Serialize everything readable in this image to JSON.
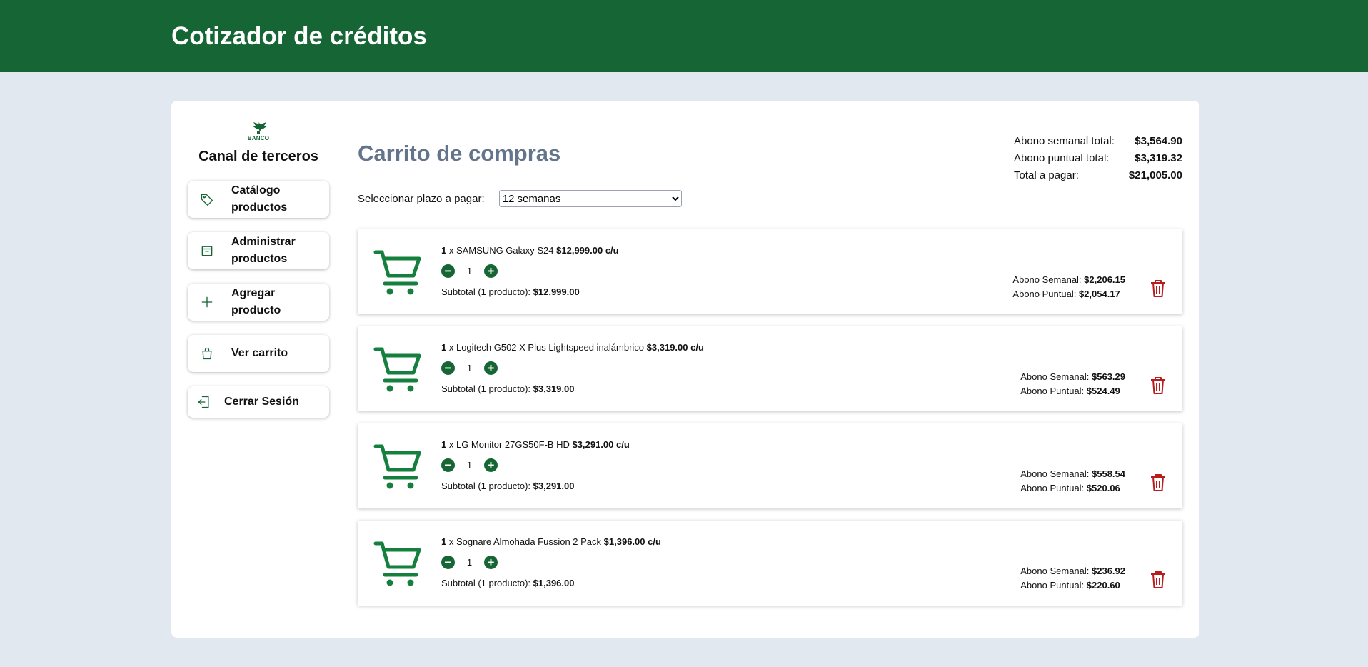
{
  "header": {
    "title": "Cotizador de créditos"
  },
  "sidebar": {
    "logo_text": "BANCO",
    "title": "Canal de terceros",
    "items": [
      {
        "label": "Catálogo productos",
        "icon": "tag-icon"
      },
      {
        "label": "Administrar productos",
        "icon": "archive-icon"
      },
      {
        "label": "Agregar producto",
        "icon": "plus-icon"
      },
      {
        "label": "Ver carrito",
        "icon": "shopping-bag-icon"
      },
      {
        "label": "Cerrar Sesión",
        "icon": "logout-icon"
      }
    ]
  },
  "cart": {
    "title": "Carrito de compras",
    "plazo_label": "Seleccionar plazo a pagar:",
    "plazo_selected": "12 semanas",
    "totals": [
      {
        "label": "Abono semanal total:",
        "value": "$3,564.90"
      },
      {
        "label": "Abono puntual total:",
        "value": "$3,319.32"
      },
      {
        "label": "Total a pagar:",
        "value": "$21,005.00"
      }
    ],
    "items": [
      {
        "qty": "1",
        "sep": " x ",
        "name": "SAMSUNG Galaxy S24",
        "price": "$12,999.00 c/u",
        "qty_value": "1",
        "subtotal_label": "Subtotal (1 producto): ",
        "subtotal": "$12,999.00",
        "semanal_label": "Abono Semanal: ",
        "semanal": "$2,206.15",
        "puntual_label": "Abono Puntual: ",
        "puntual": "$2,054.17"
      },
      {
        "qty": "1",
        "sep": " x ",
        "name": "Logitech G502 X Plus Lightspeed inalámbrico",
        "price": "$3,319.00 c/u",
        "qty_value": "1",
        "subtotal_label": "Subtotal (1 producto): ",
        "subtotal": "$3,319.00",
        "semanal_label": "Abono Semanal: ",
        "semanal": "$563.29",
        "puntual_label": "Abono Puntual: ",
        "puntual": "$524.49"
      },
      {
        "qty": "1",
        "sep": " x ",
        "name": "LG Monitor 27GS50F-B HD",
        "price": "$3,291.00 c/u",
        "qty_value": "1",
        "subtotal_label": "Subtotal (1 producto): ",
        "subtotal": "$3,291.00",
        "semanal_label": "Abono Semanal: ",
        "semanal": "$558.54",
        "puntual_label": "Abono Puntual: ",
        "puntual": "$520.06"
      },
      {
        "qty": "1",
        "sep": " x ",
        "name": "Sognare Almohada Fussion 2 Pack",
        "price": "$1,396.00 c/u",
        "qty_value": "1",
        "subtotal_label": "Subtotal (1 producto): ",
        "subtotal": "$1,396.00",
        "semanal_label": "Abono Semanal: ",
        "semanal": "$236.92",
        "puntual_label": "Abono Puntual: ",
        "puntual": "$220.60"
      }
    ]
  },
  "colors": {
    "header": "#166534",
    "accent": "#15803d",
    "danger": "#b91c1c",
    "background": "#e2e8f0",
    "title_muted": "#64748b"
  }
}
